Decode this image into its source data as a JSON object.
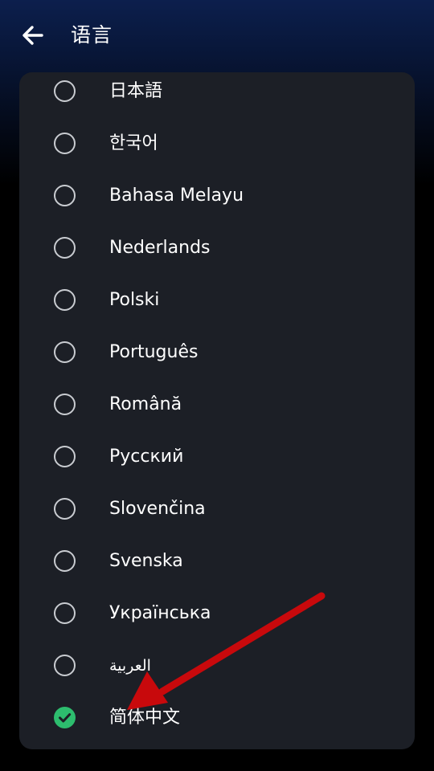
{
  "header": {
    "title": "语言",
    "back_icon": "arrow-left-icon"
  },
  "languages": [
    {
      "label": "日本語",
      "selected": false
    },
    {
      "label": "한국어",
      "selected": false
    },
    {
      "label": "Bahasa Melayu",
      "selected": false
    },
    {
      "label": "Nederlands",
      "selected": false
    },
    {
      "label": "Polski",
      "selected": false
    },
    {
      "label": "Português",
      "selected": false
    },
    {
      "label": "Română",
      "selected": false
    },
    {
      "label": "Русский",
      "selected": false
    },
    {
      "label": "Slovenčina",
      "selected": false
    },
    {
      "label": "Svenska",
      "selected": false
    },
    {
      "label": "Українська",
      "selected": false
    },
    {
      "label": "العربية",
      "selected": false
    },
    {
      "label": "简体中文",
      "selected": true
    }
  ],
  "colors": {
    "card_background": "#1c1f26",
    "selected_accent": "#2dbd6e",
    "annotation_arrow": "#c8090c"
  }
}
